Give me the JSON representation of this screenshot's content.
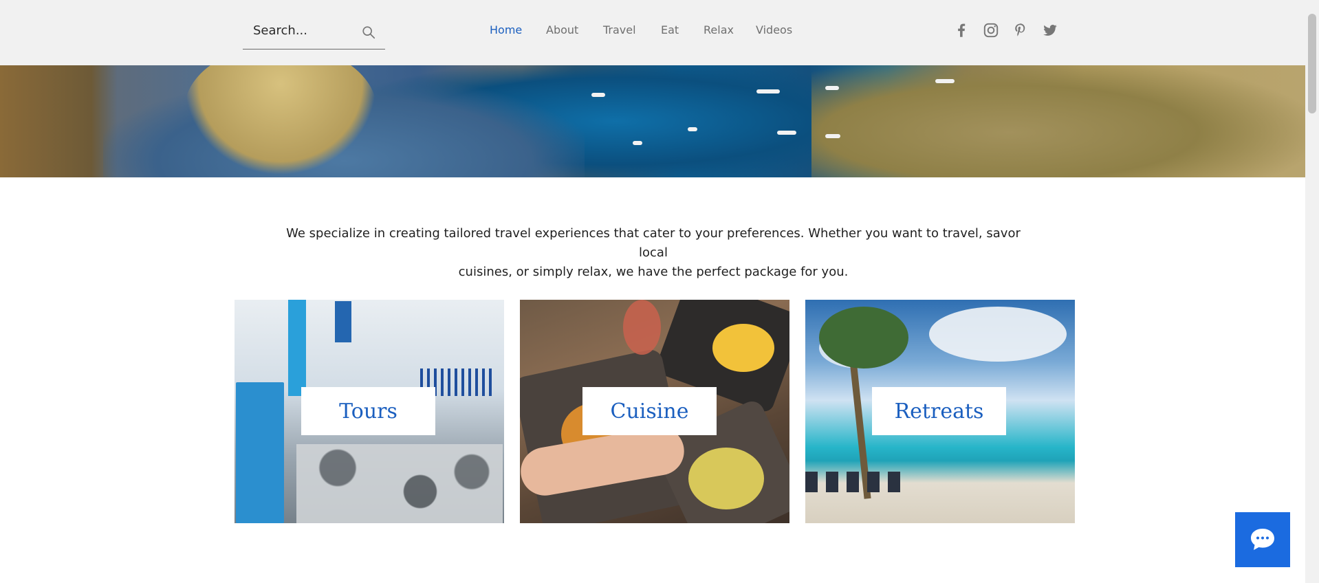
{
  "search": {
    "placeholder": "Search..."
  },
  "nav": {
    "items": [
      {
        "label": "Home",
        "active": true
      },
      {
        "label": "About",
        "active": false
      },
      {
        "label": "Travel",
        "active": false
      },
      {
        "label": "Eat",
        "active": false
      },
      {
        "label": "Relax",
        "active": false
      },
      {
        "label": "Videos",
        "active": false
      }
    ]
  },
  "social": [
    "facebook-icon",
    "instagram-icon",
    "pinterest-icon",
    "twitter-icon"
  ],
  "intro": {
    "line1": "We specialize in creating tailored travel experiences that cater to your preferences. Whether you want to travel, savor local",
    "line2": "cuisines, or simply relax, we have the perfect package for you."
  },
  "cards": [
    {
      "label": "Tours"
    },
    {
      "label": "Cuisine"
    },
    {
      "label": "Retreats"
    }
  ],
  "colors": {
    "accent": "#1b5fbf",
    "header_bg": "#f1f1f1",
    "chat_bg": "#1b6be0"
  }
}
